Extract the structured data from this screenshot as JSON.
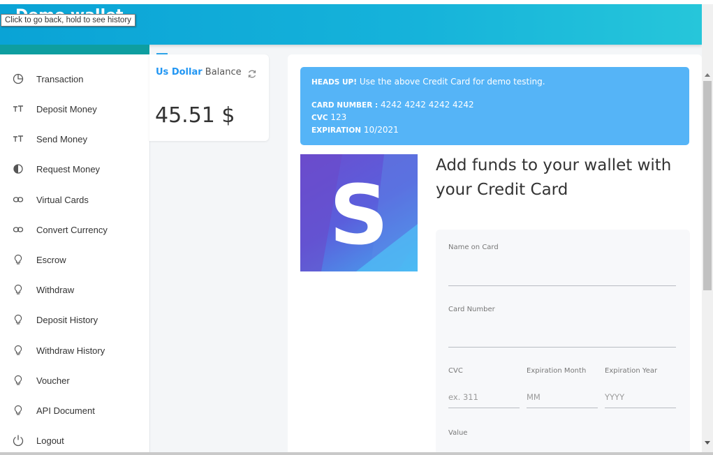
{
  "header": {
    "brand_partial": "Demo wallet"
  },
  "tooltip": {
    "text": "Click to go back, hold to see history"
  },
  "sidebar": {
    "items": [
      {
        "label": "Transaction",
        "icon": "pie-chart-icon"
      },
      {
        "label": "Deposit Money",
        "icon": "text-size-icon"
      },
      {
        "label": "Send Money",
        "icon": "text-size-icon"
      },
      {
        "label": "Request Money",
        "icon": "contrast-icon"
      },
      {
        "label": "Virtual Cards",
        "icon": "link-icon"
      },
      {
        "label": "Convert Currency",
        "icon": "link-icon"
      },
      {
        "label": "Escrow",
        "icon": "lightbulb-icon"
      },
      {
        "label": "Withdraw",
        "icon": "lightbulb-icon"
      },
      {
        "label": "Deposit History",
        "icon": "lightbulb-icon"
      },
      {
        "label": "Withdraw History",
        "icon": "lightbulb-icon"
      },
      {
        "label": "Voucher",
        "icon": "lightbulb-icon"
      },
      {
        "label": "API Document",
        "icon": "lightbulb-icon"
      },
      {
        "label": "Logout",
        "icon": "power-icon"
      }
    ]
  },
  "balance": {
    "currency": "Us Dollar",
    "label": "Balance",
    "amount": "45.51 $"
  },
  "alert": {
    "heads_up": "HEADS UP!",
    "message": "Use the above Credit Card for demo testing.",
    "card_number_label": "CARD NUMBER :",
    "card_number": "4242 4242 4242 4242",
    "cvc_label": "CVC",
    "cvc": "123",
    "expiration_label": "EXPIRATION",
    "expiration": "10/2021"
  },
  "logo": {
    "letter": "S"
  },
  "form": {
    "title": "Add funds to your wallet with your Credit Card",
    "name_label": "Name on Card",
    "name_value": "",
    "card_number_label": "Card Number",
    "card_number_value": "",
    "cvc_label": "CVC",
    "cvc_placeholder": "ex. 311",
    "exp_month_label": "Expiration Month",
    "exp_month_placeholder": "MM",
    "exp_year_label": "Expiration Year",
    "exp_year_placeholder": "YYYY",
    "value_label": "Value"
  },
  "colors": {
    "header_start": "#0aa3d6",
    "header_end": "#26c6da",
    "accent": "#2196f3",
    "alert_bg": "#55b4f7",
    "sidebar_accent": "#0e9ea0"
  }
}
